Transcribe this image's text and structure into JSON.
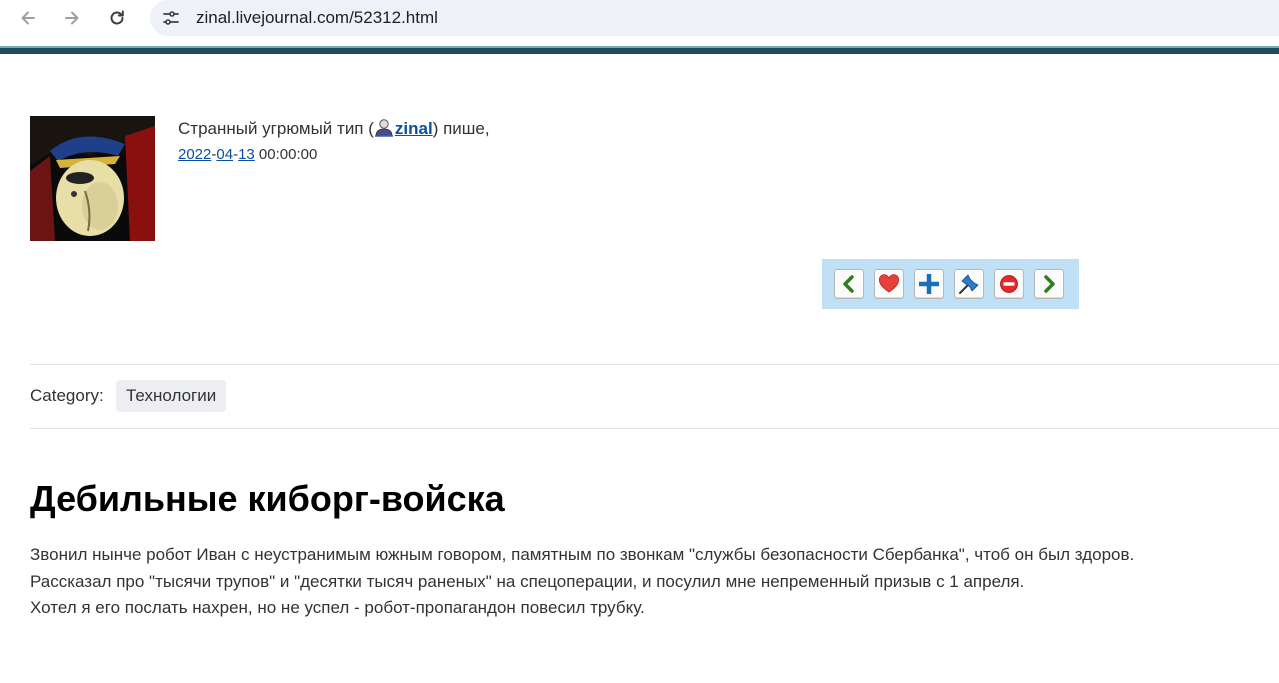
{
  "browser": {
    "url": "zinal.livejournal.com/52312.html"
  },
  "post": {
    "author_prefix": "Странный угрюмый тип (",
    "username": "zinal",
    "author_suffix": ") пише,",
    "date": {
      "year": "2022",
      "month": "04",
      "day": "13",
      "sep": "-",
      "time": "00:00:00"
    },
    "category_label": "Category:",
    "category_tag": "Технологии",
    "title": "Дебильные киборг-войска",
    "body": [
      "Звонил нынче робот Иван с неустранимым южным говором, памятным по звонкам \"службы безопасности Сбербанка\", чтоб он был здоров.",
      "Рассказал про \"тысячи трупов\" и \"десятки тысяч раненых\" на спецоперации, и посулил мне непременный призыв с 1 апреля.",
      "Хотел я его послать нахрен, но не успел - робот-пропагандон повесил трубку."
    ]
  },
  "actions": [
    {
      "icon": "prev-arrow-icon"
    },
    {
      "icon": "heart-icon"
    },
    {
      "icon": "plus-icon"
    },
    {
      "icon": "pin-icon"
    },
    {
      "icon": "block-icon"
    },
    {
      "icon": "next-arrow-icon"
    }
  ],
  "colors": {
    "header_bar": "#1e4a5e",
    "link": "#0b4fa3",
    "action_panel": "#bfe0f5"
  }
}
